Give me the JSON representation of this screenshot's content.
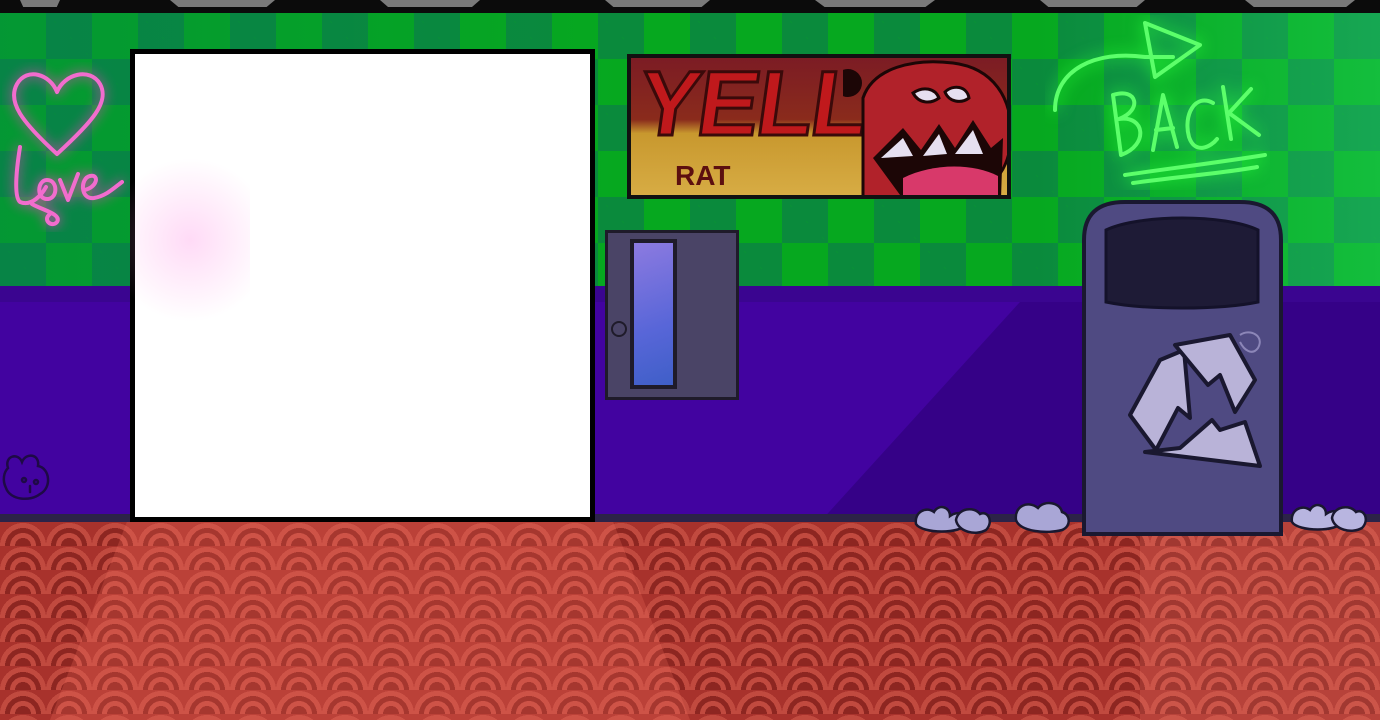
{
  "scene": {
    "name": "hallway-room"
  },
  "poster": {
    "title": "YELL",
    "subtitle": "RAT"
  },
  "neon_signs": {
    "love_text": "Love",
    "back_text": "BACK"
  },
  "colors": {
    "checker_green": "#06a81f",
    "checker_teal": "#0a8a3c",
    "purple_wall": "#4203a0",
    "floor_red": "#a8322c",
    "neon_pink": "#ff6bd6",
    "neon_green": "#5cff6a",
    "bin_purple": "#4f4a82"
  },
  "icons": {
    "love": "heart-icon",
    "back": "arrow-back-icon",
    "recycle": "recycle-icon"
  }
}
